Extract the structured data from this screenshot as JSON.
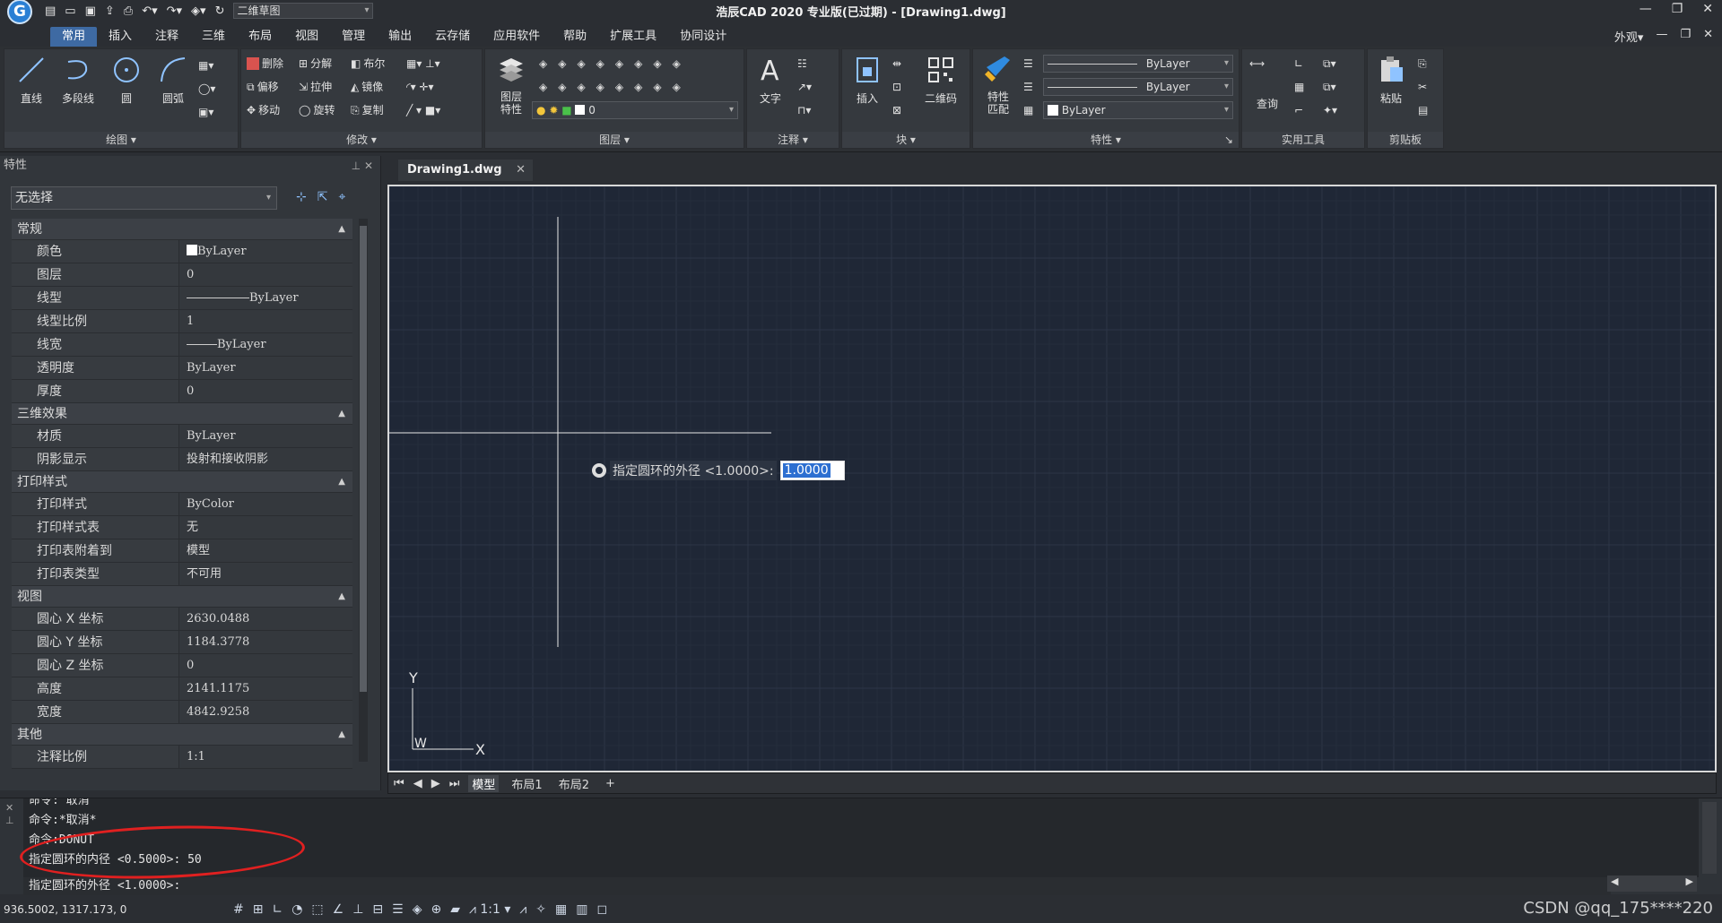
{
  "window": {
    "title": "浩辰CAD 2020 专业版(已过期) - [Drawing1.dwg]",
    "workspace": "二维草图",
    "appearance_menu": "外观",
    "logo_letter": "G"
  },
  "ribbon_tabs": [
    "常用",
    "插入",
    "注释",
    "三维",
    "布局",
    "视图",
    "管理",
    "输出",
    "云存储",
    "应用软件",
    "帮助",
    "扩展工具",
    "协同设计"
  ],
  "ribbon": {
    "draw": {
      "title": "绘图",
      "line": "直线",
      "polyline": "多段线",
      "circle": "圆",
      "arc": "圆弧"
    },
    "modify": {
      "title": "修改",
      "erase": "删除",
      "explode": "分解",
      "boolean": "布尔",
      "offset": "偏移",
      "stretch": "拉伸",
      "mirror": "镜像",
      "move": "移动",
      "rotate": "旋转",
      "copy": "复制"
    },
    "layers": {
      "title": "图层",
      "layer_props": "图层\n特性",
      "layer_value": "0"
    },
    "annotation": {
      "title": "注释",
      "text": "文字"
    },
    "block": {
      "title": "块",
      "insert": "插入",
      "qrcode": "二维码"
    },
    "properties": {
      "title": "特性",
      "match": "特性\n匹配",
      "color": "ByLayer",
      "linetype": "ByLayer",
      "lineweight": "ByLayer"
    },
    "utilities": {
      "title": "实用工具",
      "query": "查询"
    },
    "clipboard": {
      "title": "剪贴板",
      "paste": "粘贴"
    }
  },
  "properties_palette": {
    "title": "特性",
    "selection": "无选择",
    "sections": [
      {
        "name": "常规",
        "rows": [
          [
            "颜色",
            "ByLayer"
          ],
          [
            "图层",
            "0"
          ],
          [
            "线型",
            "ByLayer"
          ],
          [
            "线型比例",
            "1"
          ],
          [
            "线宽",
            "ByLayer"
          ],
          [
            "透明度",
            "ByLayer"
          ],
          [
            "厚度",
            "0"
          ]
        ]
      },
      {
        "name": "三维效果",
        "rows": [
          [
            "材质",
            "ByLayer"
          ],
          [
            "阴影显示",
            "投射和接收阴影"
          ]
        ]
      },
      {
        "name": "打印样式",
        "rows": [
          [
            "打印样式",
            "ByColor"
          ],
          [
            "打印样式表",
            "无"
          ],
          [
            "打印表附着到",
            "模型"
          ],
          [
            "打印表类型",
            "不可用"
          ]
        ]
      },
      {
        "name": "视图",
        "rows": [
          [
            "圆心 X 坐标",
            "2630.0488"
          ],
          [
            "圆心 Y 坐标",
            "1184.3778"
          ],
          [
            "圆心 Z 坐标",
            "0"
          ],
          [
            "高度",
            "2141.1175"
          ],
          [
            "宽度",
            "4842.9258"
          ]
        ]
      },
      {
        "name": "其他",
        "rows": [
          [
            "注释比例",
            "1:1"
          ]
        ]
      }
    ]
  },
  "document_tab": "Drawing1.dwg",
  "dynamic_input": {
    "prompt": "指定圆环的外径 <1.0000>:",
    "value": "1.0000"
  },
  "ucs": {
    "y_label": "Y",
    "x_label": "X",
    "w_label": "W"
  },
  "layout_tabs": [
    "模型",
    "布局1",
    "布局2",
    "+"
  ],
  "command_history": [
    "命令: 取消",
    "命令:*取消*",
    "命令:DONUT",
    "指定圆环的内径 <0.5000>: 50"
  ],
  "command_prompt": "指定圆环的外径 <1.0000>:",
  "status": {
    "coords": "936.5002, 1317.173, 0",
    "scale": "1:1"
  },
  "watermark": "CSDN @qq_175****220"
}
